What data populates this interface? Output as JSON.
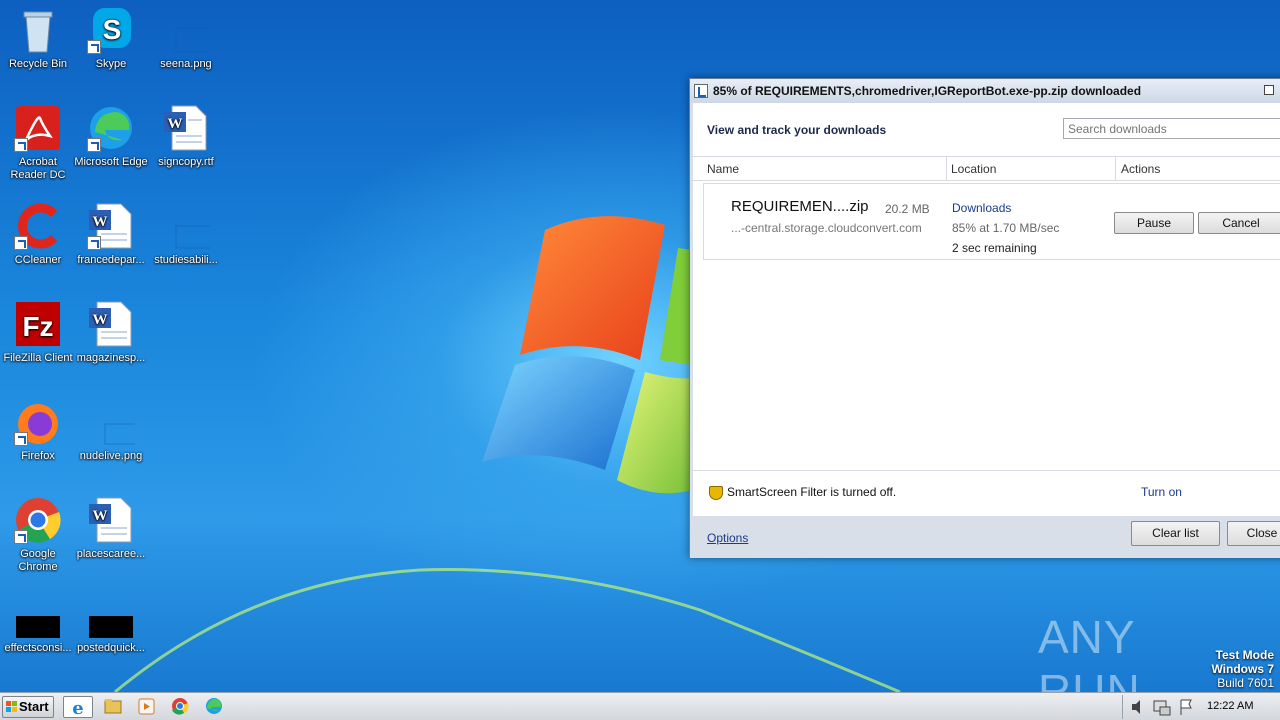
{
  "desktop": {
    "icons": [
      {
        "label": "Recycle Bin"
      },
      {
        "label": "Skype"
      },
      {
        "label": "seena.png"
      },
      {
        "label": "Acrobat\nReader DC"
      },
      {
        "label": "Microsoft Edge"
      },
      {
        "label": "signcopy.rtf"
      },
      {
        "label": "CCleaner"
      },
      {
        "label": "francedepar..."
      },
      {
        "label": "studiesabili..."
      },
      {
        "label": "FileZilla Client"
      },
      {
        "label": "magazinesp..."
      },
      {
        "label": "Firefox"
      },
      {
        "label": "nudelive.png"
      },
      {
        "label": "Google\nChrome"
      },
      {
        "label": "placescaree..."
      },
      {
        "label": "effectsconsi..."
      },
      {
        "label": "postedquick..."
      }
    ]
  },
  "download_window": {
    "title": "85% of REQUIREMENTS,chromedriver,IGReportBot.exe-pp.zip downloaded",
    "header": "View and track your downloads",
    "search_placeholder": "Search downloads",
    "columns": {
      "name": "Name",
      "location": "Location",
      "actions": "Actions"
    },
    "item": {
      "filename": "REQUIREMEN....zip",
      "size": "20.2 MB",
      "source": "...-central.storage.cloudconvert.com",
      "location": "Downloads",
      "status": "85% at 1.70 MB/sec",
      "remaining": "2 sec remaining",
      "pause_label": "Pause",
      "cancel_label": "Cancel"
    },
    "smartscreen_text": "SmartScreen Filter is turned off.",
    "turn_on_label": "Turn on",
    "options_label": "Options",
    "clear_list_label": "Clear list",
    "close_label": "Close"
  },
  "watermark": {
    "text": "ANY RUN",
    "test_mode": "Test Mode",
    "os": "Windows 7",
    "build": "Build 7601"
  },
  "taskbar": {
    "start_label": "Start",
    "clock": "12:22 AM"
  }
}
